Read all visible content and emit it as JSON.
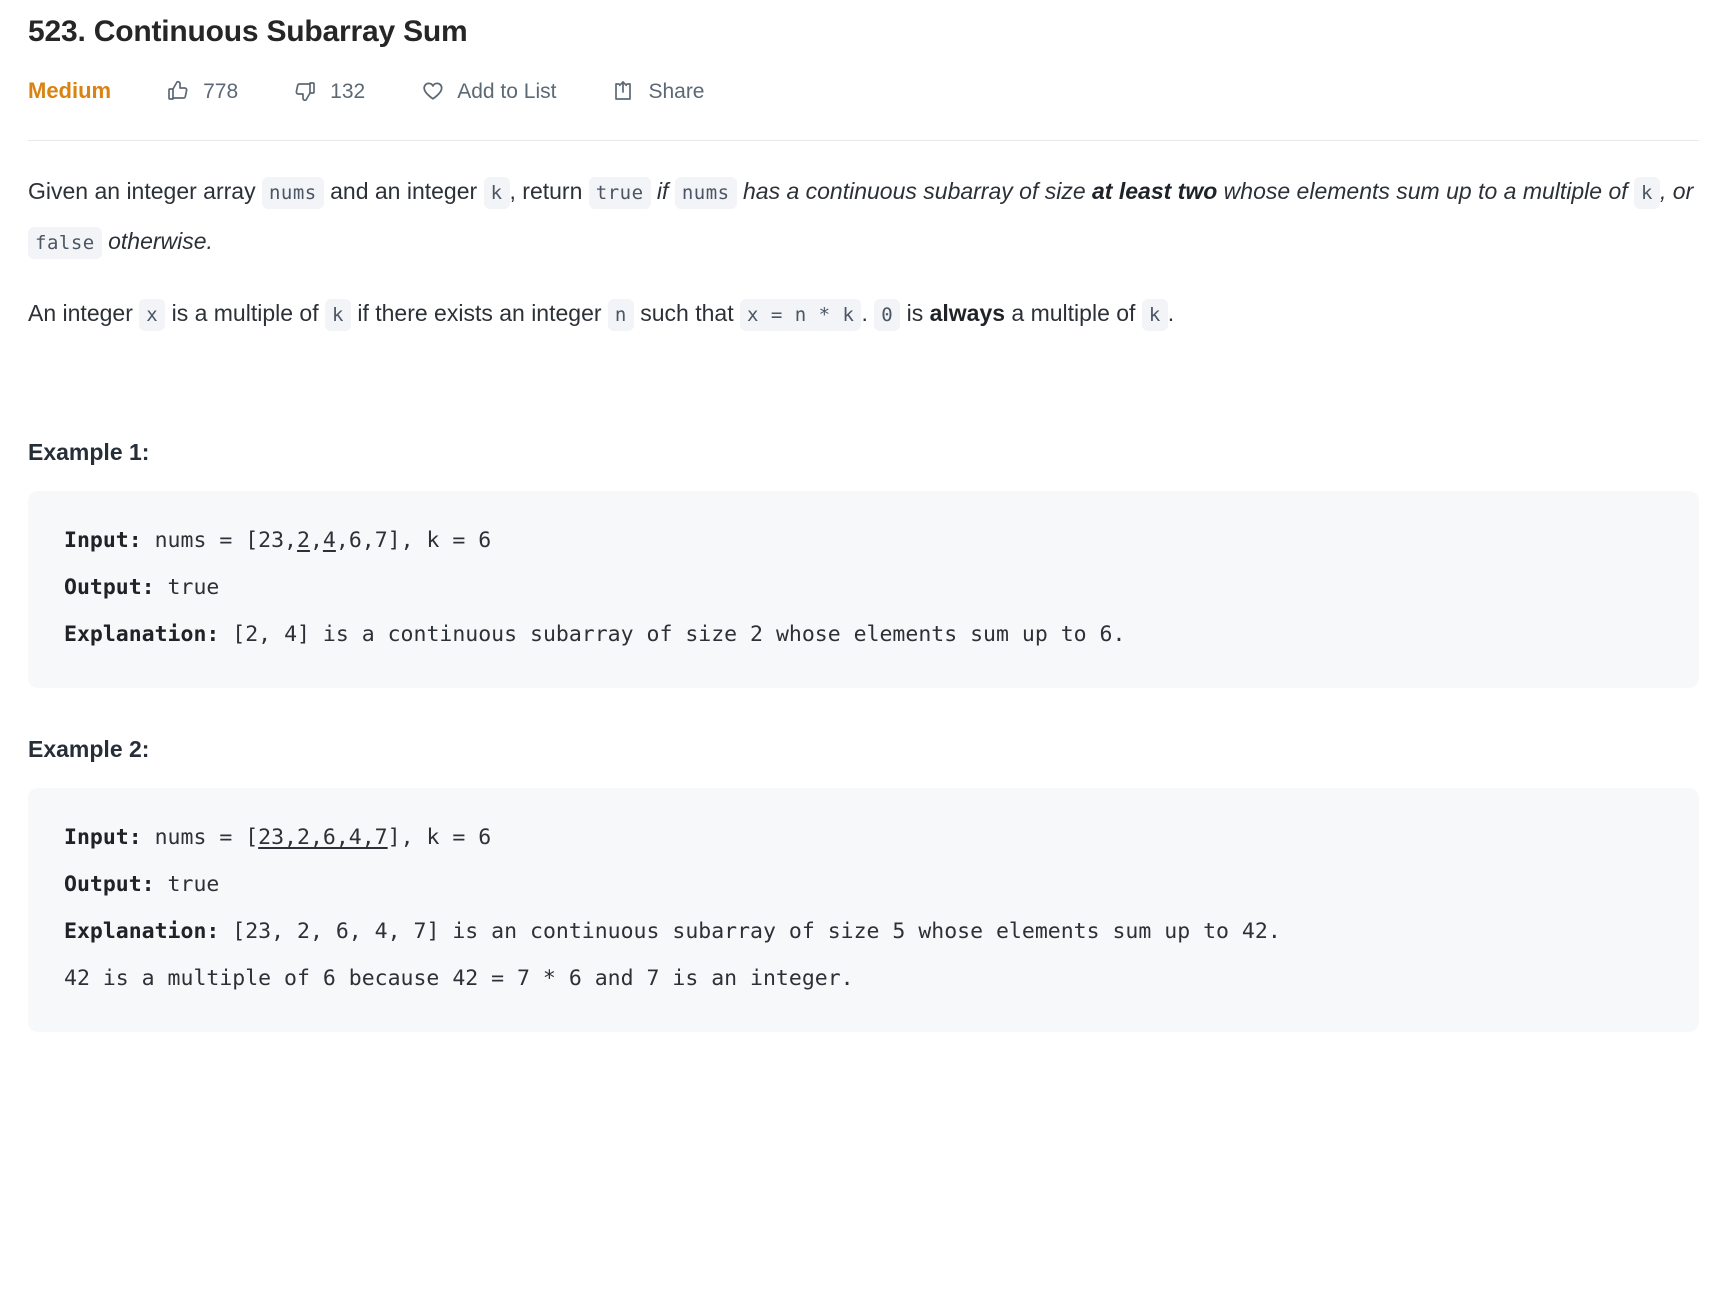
{
  "problem": {
    "number": "523.",
    "title": "523. Continuous Subarray Sum",
    "difficulty": "Medium",
    "difficulty_color": "#d98313"
  },
  "actions": {
    "likes": {
      "icon": "thumbs-up-icon",
      "count": "778"
    },
    "dislikes": {
      "icon": "thumbs-down-icon",
      "count": "132"
    },
    "add_to_list": {
      "icon": "heart-icon",
      "label": "Add to List"
    },
    "share": {
      "icon": "share-icon",
      "label": "Share"
    }
  },
  "description": {
    "p1": {
      "t1": "Given an integer array ",
      "c1": "nums",
      "t2": " and an integer ",
      "c2": "k",
      "t3": ", return ",
      "c3": "true",
      "t4": " if ",
      "c4": "nums",
      "t5": " has a continuous subarray of size ",
      "t6": "at least two",
      "t7": " whose elements sum up to a multiple of ",
      "c5": "k",
      "t8": ", or ",
      "c6": "false",
      "t9": " otherwise."
    },
    "p2": {
      "t1": "An integer ",
      "c1": "x",
      "t2": " is a multiple of ",
      "c2": "k",
      "t3": " if there exists an integer ",
      "c3": "n",
      "t4": " such that ",
      "c4": "x = n * k",
      "t5": ". ",
      "c5": "0",
      "t6": " is ",
      "t7": "always",
      "t8": " a multiple of ",
      "c6": "k",
      "t9": "."
    }
  },
  "examples": [
    {
      "heading": "Example 1:",
      "input_label": "Input:",
      "input_pre": " nums = [23,",
      "input_underline_a": "2",
      "input_mid": ",",
      "input_underline_b": "4",
      "input_post": ",6,7], k = 6",
      "output_label": "Output:",
      "output_value": " true",
      "explanation_label": "Explanation:",
      "explanation_value": " [2, 4] is a continuous subarray of size 2 whose elements sum up to 6."
    },
    {
      "heading": "Example 2:",
      "input_label": "Input:",
      "input_pre": " nums = [",
      "input_underline_all": "23,2,6,4,7",
      "input_post": "], k = 6",
      "output_label": "Output:",
      "output_value": " true",
      "explanation_label": "Explanation:",
      "explanation_value": " [23, 2, 6, 4, 7] is an continuous subarray of size 5 whose elements sum up to 42.",
      "extra_line": "42 is a multiple of 6 because 42 = 7 * 6 and 7 is an integer."
    }
  ]
}
